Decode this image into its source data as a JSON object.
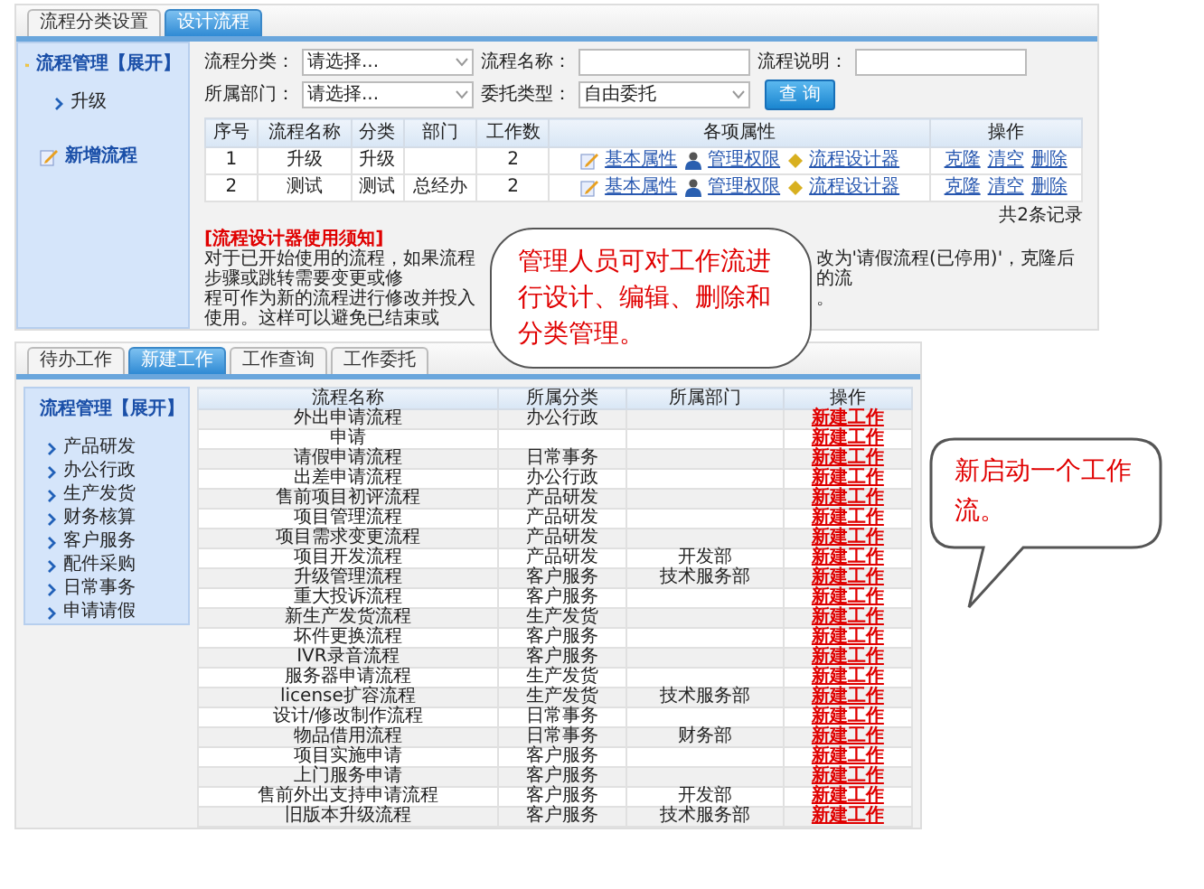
{
  "design_screen": {
    "tabs": [
      {
        "label": "流程分类设置",
        "selected": false
      },
      {
        "label": "设计流程",
        "selected": true
      }
    ],
    "sidebar": {
      "title": "流程管理【展开】",
      "items": [
        "升级"
      ],
      "action": "新增流程"
    },
    "filter_rows": [
      [
        {
          "label": "流程分类：",
          "kind": "select",
          "value": "请选择..."
        },
        {
          "label": "流程名称：",
          "kind": "input"
        },
        {
          "label": "流程说明：",
          "kind": "input"
        }
      ],
      [
        {
          "label": "所属部门：",
          "kind": "select",
          "value": "请选择..."
        },
        {
          "label": "委托类型：",
          "kind": "select",
          "value": "自由委托"
        }
      ]
    ],
    "search_button": "查 询",
    "table": {
      "columns": [
        "序号",
        "流程名称",
        "分类",
        "部门",
        "工作数",
        "各项属性",
        "操作"
      ],
      "rows": [
        {
          "index": "1",
          "name": "升级",
          "category": "升级",
          "work_count": "2",
          "properties": [
            "基本属性",
            "管理权限",
            "流程设计器"
          ],
          "actions": [
            "克隆",
            "清空",
            "删除"
          ]
        },
        {
          "index": "2",
          "name": "测试",
          "category": "测试",
          "department": "总经办",
          "work_count": "2",
          "properties": [
            "基本属性",
            "管理权限",
            "流程设计器"
          ],
          "actions": [
            "克隆",
            "清空",
            "删除"
          ]
        }
      ]
    },
    "record_count": "共2条记录",
    "notice": {
      "title": "[流程设计器使用须知]",
      "left_fragments": [
        "对于已开始使用的流程，如果流程步骤或跳转需要变更或修",
        "程可作为新的流程进行修改并投入使用。这样可以避免已结束或"
      ],
      "right_fragments": [
        "改为'请假流程(已停用)'，克隆后的流",
        "。"
      ]
    }
  },
  "new_work_screen": {
    "tabs": [
      {
        "label": "待办工作",
        "selected": false
      },
      {
        "label": "新建工作",
        "selected": true
      },
      {
        "label": "工作查询",
        "selected": false
      },
      {
        "label": "工作委托",
        "selected": false
      }
    ],
    "sidebar": {
      "title": "流程管理【展开】",
      "items": [
        "产品研发",
        "办公行政",
        "生产发货",
        "财务核算",
        "客户服务",
        "配件采购",
        "日常事务",
        "申请请假"
      ]
    },
    "table": {
      "columns": [
        "流程名称",
        "所属分类",
        "所属部门",
        "操作"
      ],
      "rows": [
        {
          "name": "外出申请流程",
          "category": "办公行政",
          "action": "新建工作"
        },
        {
          "name": "申请",
          "action": "新建工作"
        },
        {
          "name": "请假申请流程",
          "category": "日常事务",
          "action": "新建工作"
        },
        {
          "name": "出差申请流程",
          "category": "办公行政",
          "action": "新建工作"
        },
        {
          "name": "售前项目初评流程",
          "category": "产品研发",
          "action": "新建工作"
        },
        {
          "name": "项目管理流程",
          "category": "产品研发",
          "action": "新建工作"
        },
        {
          "name": "项目需求变更流程",
          "category": "产品研发",
          "action": "新建工作"
        },
        {
          "name": "项目开发流程",
          "category": "产品研发",
          "department": "开发部",
          "action": "新建工作"
        },
        {
          "name": "升级管理流程",
          "category": "客户服务",
          "department": "技术服务部",
          "action": "新建工作"
        },
        {
          "name": "重大投诉流程",
          "category": "客户服务",
          "action": "新建工作"
        },
        {
          "name": "新生产发货流程",
          "category": "生产发货",
          "action": "新建工作"
        },
        {
          "name": "坏件更换流程",
          "category": "客户服务",
          "action": "新建工作"
        },
        {
          "name": "IVR录音流程",
          "category": "客户服务",
          "action": "新建工作"
        },
        {
          "name": "服务器申请流程",
          "category": "生产发货",
          "action": "新建工作"
        },
        {
          "name": "license扩容流程",
          "category": "生产发货",
          "department": "技术服务部",
          "action": "新建工作"
        },
        {
          "name": "设计/修改制作流程",
          "category": "日常事务",
          "action": "新建工作"
        },
        {
          "name": "物品借用流程",
          "category": "日常事务",
          "department": "财务部",
          "action": "新建工作"
        },
        {
          "name": "项目实施申请",
          "category": "客户服务",
          "action": "新建工作"
        },
        {
          "name": "上门服务申请",
          "category": "客户服务",
          "action": "新建工作"
        },
        {
          "name": "售前外出支持申请流程",
          "category": "客户服务",
          "department": "开发部",
          "action": "新建工作"
        },
        {
          "name": "旧版本升级流程",
          "category": "客户服务",
          "department": "技术服务部",
          "action": "新建工作"
        }
      ]
    }
  },
  "callouts": [
    {
      "kind": "box",
      "text": "管理人员可对工作流进行设计、编辑、删除和分类管理。"
    },
    {
      "kind": "speech",
      "text": "新启动一个工作流。"
    }
  ]
}
